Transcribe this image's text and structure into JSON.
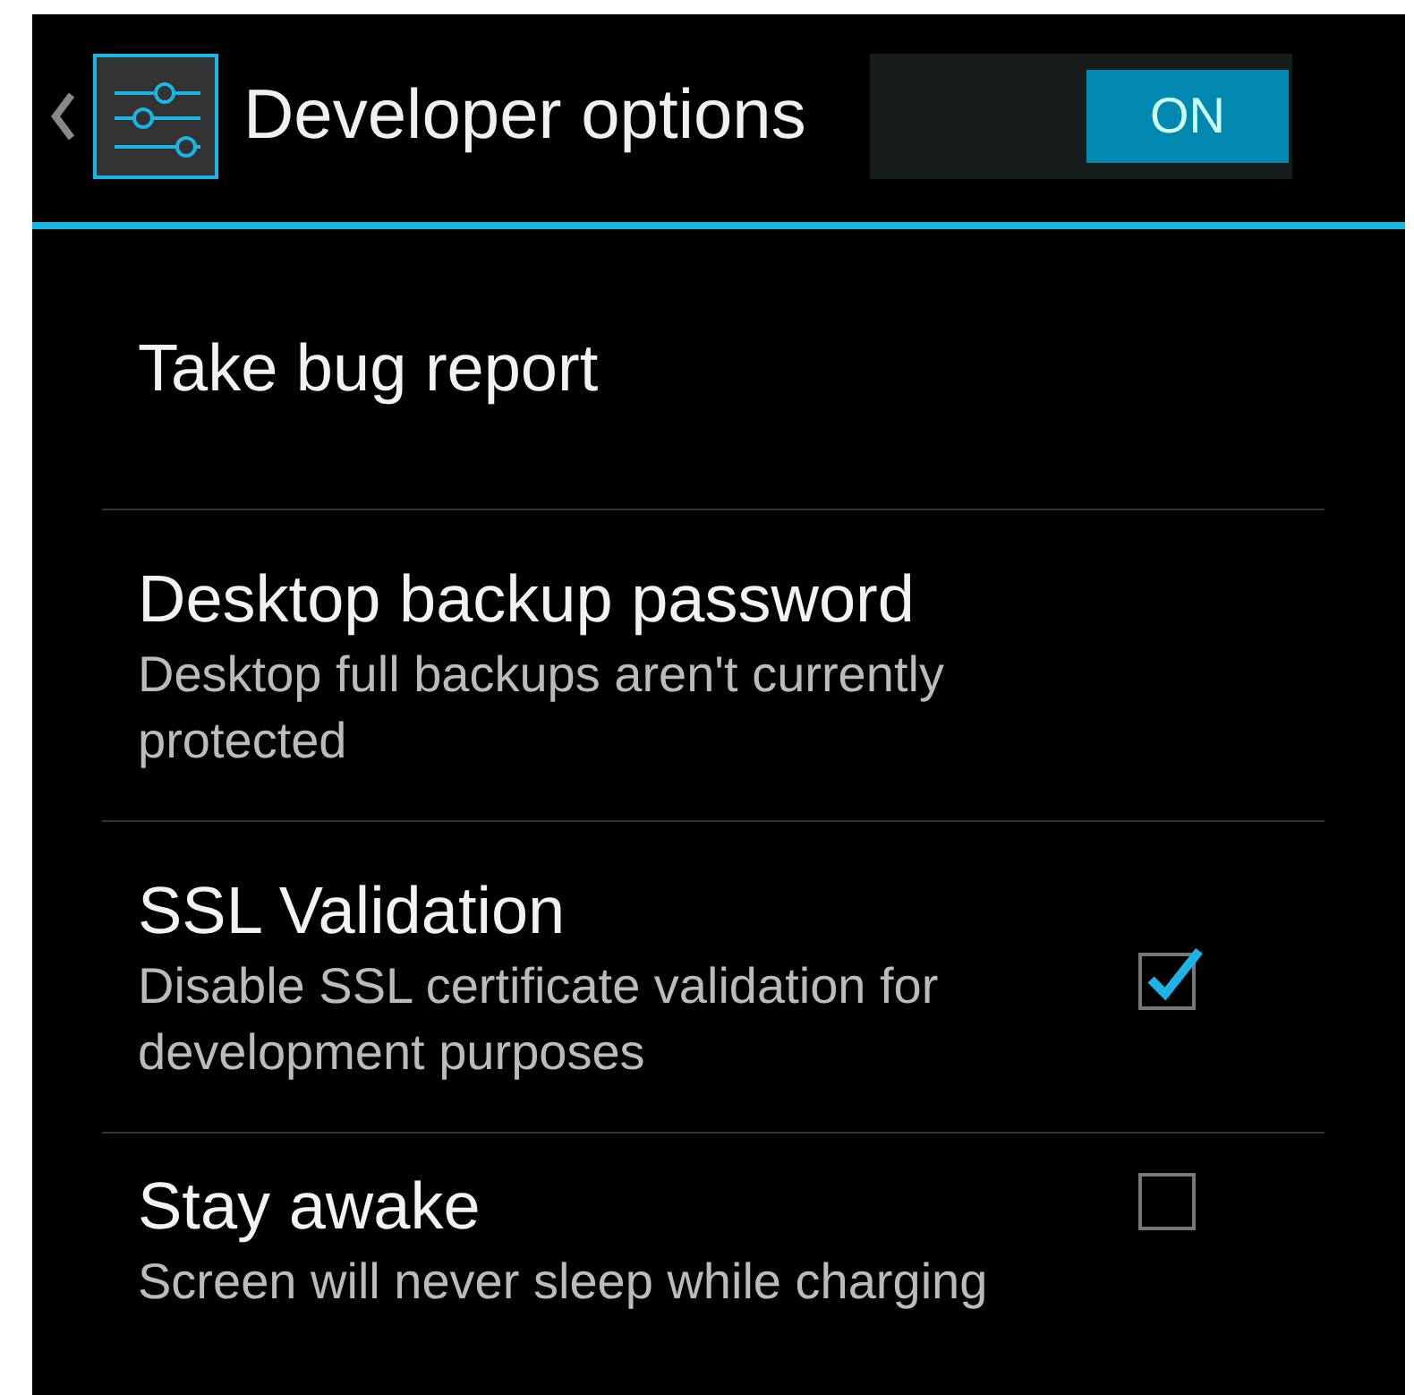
{
  "action_bar": {
    "title": "Developer options",
    "master_switch": {
      "label": "ON",
      "on": true
    }
  },
  "settings": [
    {
      "kind": "plain",
      "title": "Take bug report"
    },
    {
      "kind": "plain",
      "title": "Desktop backup password",
      "summary": "Desktop full backups aren't currently protected"
    },
    {
      "kind": "checkbox",
      "title": "SSL Validation",
      "summary": "Disable SSL certificate validation for development purposes",
      "checked": true
    },
    {
      "kind": "checkbox",
      "title": "Stay awake",
      "summary": "Screen will never sleep while charging",
      "checked": false
    }
  ]
}
